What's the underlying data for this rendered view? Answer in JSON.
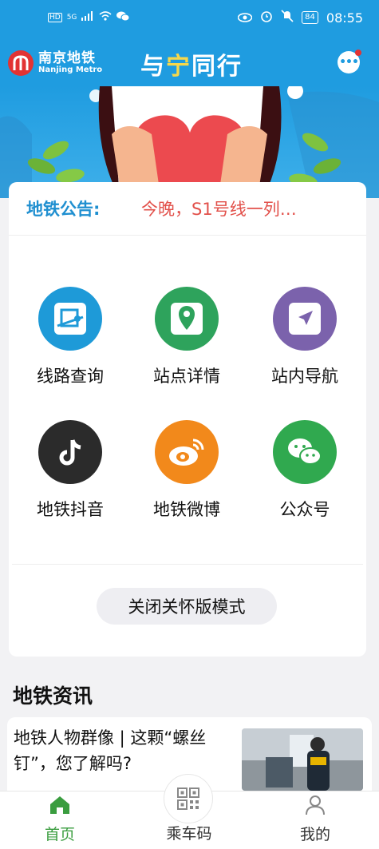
{
  "status_bar": {
    "left_badges": [
      "HD",
      "5G"
    ],
    "time": "08:55",
    "battery": "84"
  },
  "header": {
    "logo_cn": "南京地铁",
    "logo_en": "Nanjing Metro",
    "slogan_part1": "与",
    "slogan_part2": "宁",
    "slogan_part3": "同行"
  },
  "notice": {
    "label": "地铁公告:",
    "text": "今晚，S1号线一列…"
  },
  "grid": [
    {
      "label": "线路查询",
      "icon": "route-icon",
      "color": "#1e9ad8"
    },
    {
      "label": "站点详情",
      "icon": "location-pin-icon",
      "color": "#2ea35c"
    },
    {
      "label": "站内导航",
      "icon": "navigation-arrow-icon",
      "color": "#7b62ac"
    },
    {
      "label": "地铁抖音",
      "icon": "tiktok-icon",
      "color": "#2b2b2b"
    },
    {
      "label": "地铁微博",
      "icon": "weibo-icon",
      "color": "#f2891b"
    },
    {
      "label": "公众号",
      "icon": "wechat-icon",
      "color": "#30a94f"
    }
  ],
  "care_mode_button": "关闭关怀版模式",
  "news": {
    "section_title": "地铁资讯",
    "item_title": "地铁人物群像 | 这颗“螺丝钉”，您了解吗?"
  },
  "tabbar": {
    "home": "首页",
    "ride_code": "乘车码",
    "mine": "我的",
    "active_color": "#3a9d3f"
  }
}
